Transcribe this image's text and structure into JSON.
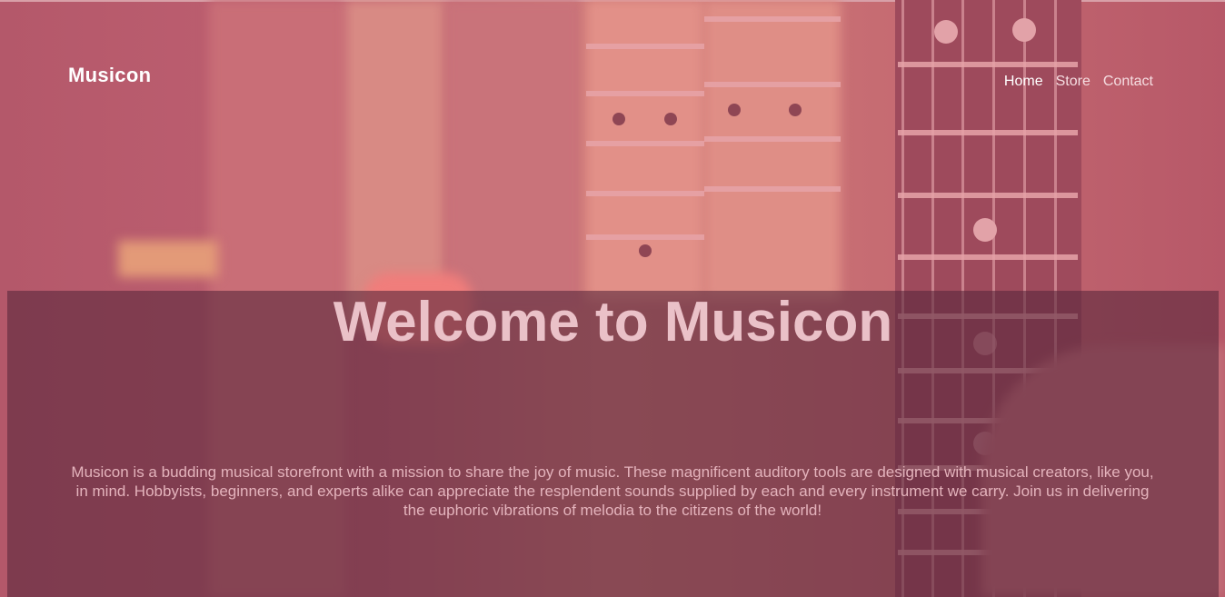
{
  "header": {
    "logo": "Musicon",
    "nav": [
      {
        "label": "Home",
        "active": true
      },
      {
        "label": "Store",
        "active": false
      },
      {
        "label": "Contact",
        "active": false
      }
    ]
  },
  "hero": {
    "title": "Welcome to Musicon",
    "description": "Musicon is a budding musical storefront with a mission to share the joy of music. These magnificent auditory tools are designed with musical creators, like you, in mind. Hobbyists, beginners, and experts alike can appreciate the resplendent sounds supplied by each and every instrument we carry. Join us in delivering the euphoric vibrations of melodia to the citizens of the world!"
  },
  "colors": {
    "overlay": "#b85a6a",
    "panel": "#5a283c",
    "title": "#eac1c8",
    "text": "#e4b3bc"
  }
}
